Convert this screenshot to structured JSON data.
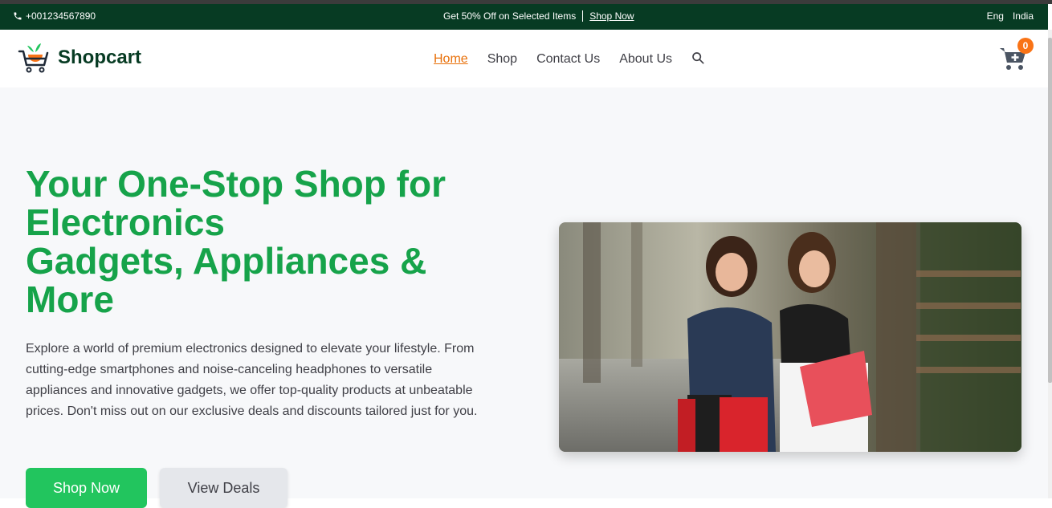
{
  "topbar": {
    "phone": "+001234567890",
    "promo_text": "Get 50% Off on Selected Items",
    "promo_link": "Shop Now",
    "language": "Eng",
    "country": "India"
  },
  "navbar": {
    "brand": "Shopcart",
    "links": [
      "Home",
      "Shop",
      "Contact Us",
      "About Us"
    ],
    "active_link": "Home",
    "cart_count": "0"
  },
  "hero": {
    "title_lines": [
      "Your One-Stop Shop for",
      "Electronics",
      "Gadgets, Appliances &",
      "More"
    ],
    "description": "Explore a world of premium electronics designed to elevate your lifestyle. From cutting-edge smartphones and noise-canceling headphones to versatile appliances and innovative gadgets, we offer top-quality products at unbeatable prices. Don't miss out on our exclusive deals and discounts tailored just for you.",
    "primary_button": "Shop Now",
    "secondary_button": "View Deals"
  },
  "colors": {
    "topbar_bg": "#073b23",
    "accent_green": "#16a34a",
    "button_green": "#22c55e",
    "active_link": "#e8700a",
    "badge_orange": "#f97316"
  },
  "icons": {
    "phone": "phone-icon",
    "logo": "shopping-cart-logo-icon",
    "search": "search-icon",
    "cart": "cart-plus-icon"
  }
}
